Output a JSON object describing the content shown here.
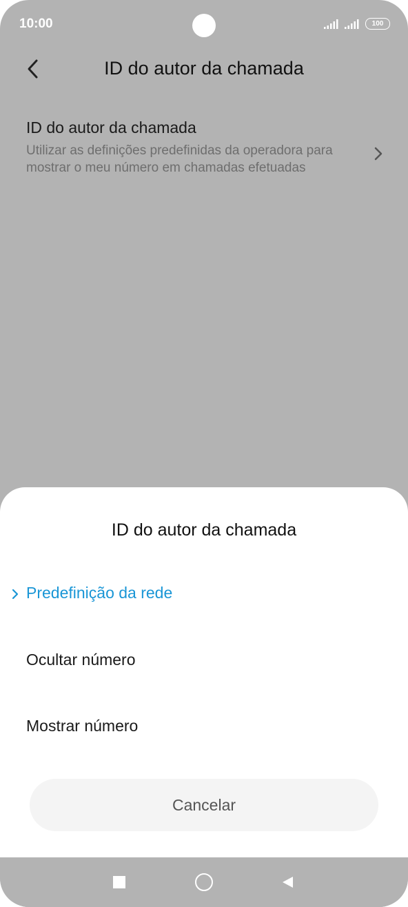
{
  "status_bar": {
    "time": "10:00",
    "battery": "100",
    "icons": [
      "signal-icon",
      "signal-icon",
      "battery-icon"
    ]
  },
  "header": {
    "title": "ID do autor da chamada",
    "back_icon": "chevron-left-icon"
  },
  "setting": {
    "title": "ID do autor da chamada",
    "description": "Utilizar as definições predefinidas da operadora para mostrar o meu número em chamadas efetuadas"
  },
  "sheet": {
    "title": "ID do autor da chamada",
    "options": [
      {
        "label": "Predefinição da rede",
        "selected": true
      },
      {
        "label": "Ocultar número",
        "selected": false
      },
      {
        "label": "Mostrar número",
        "selected": false
      }
    ],
    "cancel_label": "Cancelar"
  },
  "colors": {
    "accent": "#1a96d6",
    "dim_background": "#b3b3b3"
  }
}
